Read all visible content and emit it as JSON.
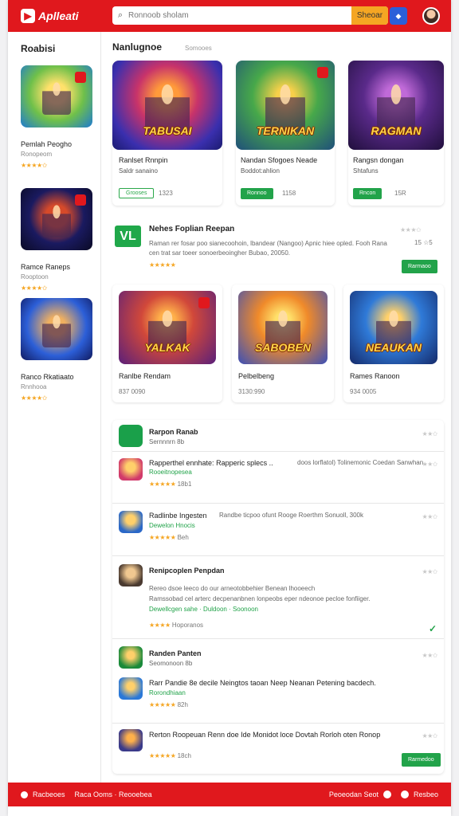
{
  "app": {
    "logo_icon": "app-logo-icon",
    "name": "Aplleati"
  },
  "search": {
    "placeholder": "Ronnoob sholam",
    "button_label": "Sheoar",
    "icon": "search-icon"
  },
  "sidebar": {
    "title": "Roabisi",
    "items": [
      {
        "name": "Pemlah Peogho",
        "sub": "Ronopeom",
        "rating": "★★★★✩"
      },
      {
        "name": "Ramce Raneps",
        "sub": "Rooptoon",
        "rating": "★★★★✩"
      },
      {
        "name": "Ranco Rkatiaato",
        "sub": "Rnnhooa",
        "rating": "★★★★✩"
      }
    ]
  },
  "top_section": {
    "title": "Nanlugnoe",
    "subtitle": "Somooes",
    "cards": [
      {
        "art_caption": "TABUSAI",
        "name": "Ranlset Rnnpin",
        "sub": "Saldr sanaino",
        "button": "Grooses",
        "meta": "1323"
      },
      {
        "art_caption": "TERNIKAN",
        "name": "Nandan Sfogoes Neade",
        "sub": "Boddot:ahlion",
        "button": "Ronnoo",
        "meta": "1158"
      },
      {
        "art_caption": "RAGMAN",
        "name": "Rangsn dongan",
        "sub": "Shtafuns",
        "button": "Rncon",
        "meta": "15R"
      }
    ]
  },
  "featured": {
    "icon_text": "VL",
    "title": "Nehes Foplian Reepan",
    "description": "Raman rer fosar poo sianecoohoin, lbandear (Nangoo) Apnic hiee opled. Fooh Rana cen trat sar toeer sonoerbeoingher Bubao, 20050.",
    "stars": "★★★★★",
    "rating": "★★★✩",
    "count": "15 ☆5",
    "button": "Rarmaoo"
  },
  "mid_cards": [
    {
      "art_caption": "YALKAK",
      "name": "Ranlbe Rendam",
      "meta": "837 0090"
    },
    {
      "art_caption": "SABOBEN",
      "name": "Pelbelbeng",
      "meta": "3130:990"
    },
    {
      "art_caption": "NEAUKAN",
      "name": "Rames Ranoon",
      "meta": "934 0005"
    }
  ],
  "list": {
    "rows": [
      {
        "title": "Rarpon Ranab",
        "sub": "Sernnnrn 8b",
        "rating": "★★✩"
      },
      {
        "title": "Rapperthel ennhate: Rapperic splecs ..",
        "desc": "doos lorflatol) Tolinemonic Coedan Sanwhan..",
        "green": "Rooeitnopesea",
        "stars": "★★★★★",
        "meta": "18b1",
        "rating": "★★✩"
      },
      {
        "title": "Radlinbe Ingesten",
        "desc": "Randbe ticpoo ofunt Rooge Roerthm Sonuoll, 300k",
        "green": "Dewelon Hnocis",
        "stars": "★★★★★",
        "meta": "Beh",
        "rating": "★★✩"
      },
      {
        "title": "Renipcoplen Penpdan",
        "desc": "Rereo dsoe leeco do our arneotobbehier Benean lhooeech",
        "desc2": "Ramssobad cel arterc decpenanbnen lonpeobs eper ndeonoe pecloe fonfiiger.",
        "green": "Dewellcgen sahe · Duldoon · Soonoon",
        "stars": "★★★★",
        "meta": "Hoporanos",
        "rating": "★★✩"
      },
      {
        "title": "Randen Panten",
        "sub": "Seomonoon 8b",
        "rating": "★★✩"
      },
      {
        "title": "Rarr Pandie 8e decile Neingtos taoan Neep Neanan Petening bacdech.",
        "green": "Rorondhiaan",
        "stars": "★★★★★",
        "meta": "82h"
      },
      {
        "title": "Rerton Roopeuan Renn doe Ide Monidot loce Dovtah Rorloh oten Ronop",
        "stars": "★★★★★",
        "meta": "18ch",
        "rating": "★★✩",
        "button": "Rarmedoo"
      }
    ]
  },
  "footer": {
    "left_text": "Racbeoes",
    "left_text2": "Raca Ooms · Reooebea",
    "right_text": "Peoeodan Seot",
    "right_text2": "Resbeo"
  },
  "colors": {
    "brand_red": "#e0181d",
    "accent_orange": "#f5a623",
    "action_green": "#22a34a"
  }
}
